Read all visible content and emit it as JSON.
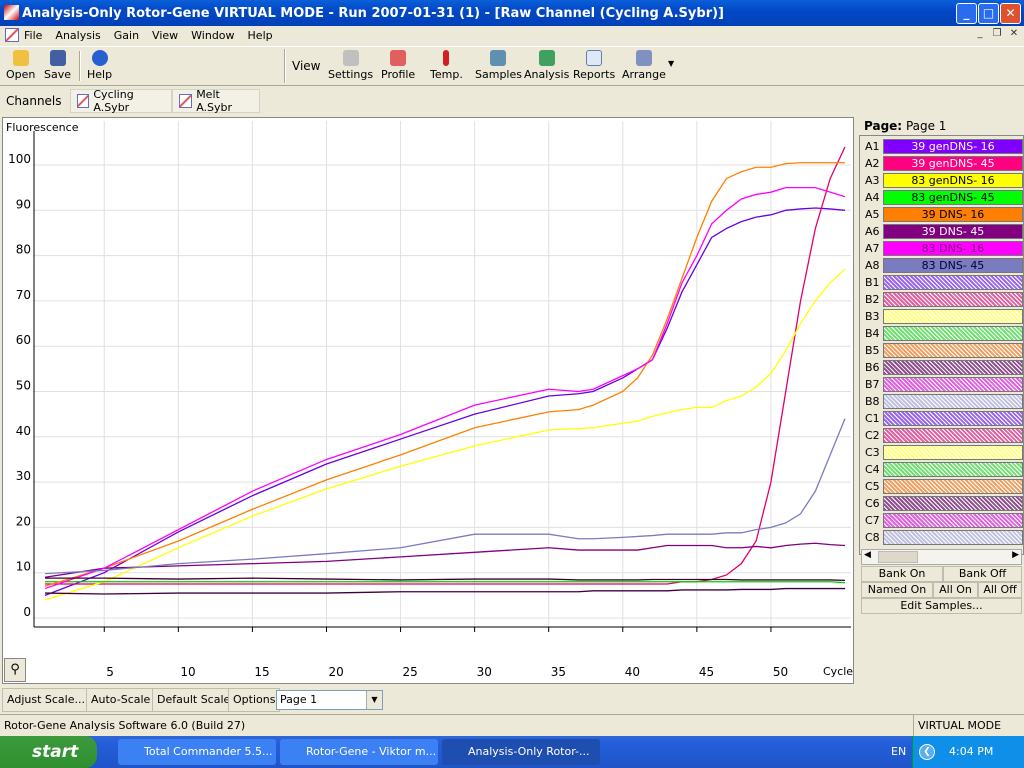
{
  "window": {
    "title": "Analysis-Only Rotor-Gene VIRTUAL MODE - Run 2007-01-31 (1) - [Raw Channel (Cycling A.Sybr)]",
    "minimize": "_",
    "maximize": "□",
    "close": "✕"
  },
  "menu": [
    "File",
    "Analysis",
    "Gain",
    "View",
    "Window",
    "Help"
  ],
  "toolbar": {
    "open": "Open",
    "save": "Save",
    "help": "Help",
    "view": "View",
    "settings": "Settings",
    "profile": "Profile",
    "temp": "Temp.",
    "samples": "Samples",
    "analysis": "Analysis",
    "reports": "Reports",
    "arrange": "Arrange"
  },
  "channels": {
    "label": "Channels",
    "items": [
      "Cycling A.Sybr",
      "Melt A.Sybr"
    ]
  },
  "panel": {
    "page_label": "Page:",
    "page_value": "Page 1",
    "samples": [
      {
        "id": "A1",
        "name": "39 genDNS- 16",
        "color": "#8000ff",
        "text": "#ffffff"
      },
      {
        "id": "A2",
        "name": "39 genDNS- 45",
        "color": "#ff0080",
        "text": "#ffffff"
      },
      {
        "id": "A3",
        "name": "83 genDNS- 16",
        "color": "#ffff00",
        "text": "#000000"
      },
      {
        "id": "A4",
        "name": "83 genDNS- 45",
        "color": "#00ff00",
        "text": "#000000"
      },
      {
        "id": "A5",
        "name": "39 DNS- 16",
        "color": "#ff8000",
        "text": "#000000"
      },
      {
        "id": "A6",
        "name": "39 DNS- 45",
        "color": "#800080",
        "text": "#ffffff"
      },
      {
        "id": "A7",
        "name": "83 DNS- 16",
        "color": "#ff00ff",
        "text": "#800080"
      },
      {
        "id": "A8",
        "name": "83 DNS- 45",
        "color": "#7b7bc0",
        "text": "#000040"
      },
      {
        "id": "B1",
        "name": "",
        "color": "#9966ee"
      },
      {
        "id": "B2",
        "name": "",
        "color": "#e060a0"
      },
      {
        "id": "B3",
        "name": "",
        "color": "#ffff80"
      },
      {
        "id": "B4",
        "name": "",
        "color": "#70e070"
      },
      {
        "id": "B5",
        "name": "",
        "color": "#f0a060"
      },
      {
        "id": "B6",
        "name": "",
        "color": "#905090"
      },
      {
        "id": "B7",
        "name": "",
        "color": "#e060e0"
      },
      {
        "id": "B8",
        "name": "",
        "color": "#c0c0e0"
      },
      {
        "id": "C1",
        "name": "",
        "color": "#9966ee"
      },
      {
        "id": "C2",
        "name": "",
        "color": "#e060a0"
      },
      {
        "id": "C3",
        "name": "",
        "color": "#ffff80"
      },
      {
        "id": "C4",
        "name": "",
        "color": "#70e070"
      },
      {
        "id": "C5",
        "name": "",
        "color": "#f0a060"
      },
      {
        "id": "C6",
        "name": "",
        "color": "#905090"
      },
      {
        "id": "C7",
        "name": "",
        "color": "#e060e0"
      },
      {
        "id": "C8",
        "name": "",
        "color": "#c0c0e0"
      }
    ],
    "bank_on": "Bank On",
    "bank_off": "Bank Off",
    "named_on": "Named On",
    "all_on": "All On",
    "all_off": "All Off",
    "edit_samples": "Edit Samples..."
  },
  "bottom": {
    "adjust_scale": "Adjust Scale...",
    "auto_scale": "Auto-Scale",
    "default_scale": "Default Scale",
    "options": "Options",
    "page_select": "Page 1"
  },
  "status": {
    "left": "Rotor-Gene Analysis Software 6.0 (Build 27)",
    "right": "VIRTUAL MODE"
  },
  "taskbar": {
    "start": "start",
    "tasks": [
      "Total Commander 5.5...",
      "Rotor-Gene - Viktor m...",
      "Analysis-Only Rotor-..."
    ],
    "lang": "EN",
    "clock": "4:04 PM"
  },
  "chart_data": {
    "type": "line",
    "ylabel": "Fluorescence",
    "xlabel": "Cycle",
    "xlim": [
      1,
      55
    ],
    "ylim": [
      -2,
      110
    ],
    "xticks": [
      5,
      10,
      15,
      20,
      25,
      30,
      35,
      40,
      45,
      50
    ],
    "yticks": [
      0,
      10,
      20,
      30,
      40,
      50,
      60,
      70,
      80,
      90,
      100
    ],
    "grid": true,
    "x": [
      1,
      5,
      10,
      15,
      20,
      25,
      30,
      35,
      37,
      38,
      40,
      41,
      42,
      43,
      44,
      45,
      46,
      47,
      48,
      49,
      50,
      51,
      52,
      53,
      54,
      55
    ],
    "series": [
      {
        "name": "39 genDNS- 16",
        "color": "#6a00e0",
        "values": [
          5,
          10,
          19,
          27,
          34,
          39.5,
          45,
          49,
          49.5,
          50,
          53,
          55,
          57,
          64,
          72,
          78,
          84,
          86,
          87.5,
          88.5,
          89,
          90,
          90.3,
          90.5,
          90.3,
          90
        ]
      },
      {
        "name": "39 genDNS- 45",
        "color": "#e0006a",
        "values": [
          7.5,
          7.5,
          7.5,
          7.5,
          7.5,
          7.5,
          7.5,
          7.5,
          7.5,
          7.5,
          7.5,
          7.5,
          7.5,
          7.5,
          8,
          8,
          8.5,
          9.5,
          12,
          17,
          30,
          50,
          70,
          86,
          97,
          104
        ]
      },
      {
        "name": "83 genDNS- 16",
        "color": "#ffff00",
        "values": [
          4,
          8,
          15.5,
          22.5,
          28.5,
          33.5,
          38,
          41.5,
          41.8,
          42,
          43,
          43.5,
          44.5,
          45.3,
          46,
          46.5,
          46.5,
          48,
          49,
          51,
          54,
          59,
          65,
          70,
          74,
          77
        ]
      },
      {
        "name": "83 genDNS- 45",
        "color": "#00d000",
        "values": [
          8,
          8,
          8,
          8,
          8,
          8,
          8,
          8,
          8,
          8,
          8,
          8,
          8,
          8,
          8,
          8,
          8,
          8,
          8,
          8,
          8,
          8,
          8,
          8,
          8,
          7.8
        ]
      },
      {
        "name": "39 DNS- 16",
        "color": "#ff8000",
        "values": [
          7,
          11,
          17,
          24,
          30.5,
          36,
          42,
          45.5,
          46,
          47,
          50,
          53,
          58,
          66,
          75,
          84,
          92,
          97,
          98.5,
          99.5,
          99.5,
          100.3,
          100.5,
          100.5,
          100.5,
          100.5
        ]
      },
      {
        "name": "39 DNS- 45",
        "color": "#800080",
        "values": [
          9,
          11,
          11.5,
          12,
          12.5,
          13.5,
          14.5,
          15.5,
          15,
          15,
          15,
          15,
          15.5,
          16,
          16,
          16,
          16,
          15.5,
          15.5,
          15.8,
          15.5,
          16,
          16.3,
          16.5,
          16.2,
          16
        ]
      },
      {
        "name": "83 DNS- 16",
        "color": "#ff00ff",
        "values": [
          6.5,
          11,
          19.5,
          28,
          35,
          40.5,
          47,
          50.5,
          50,
          50.5,
          53.5,
          55,
          57,
          65,
          74,
          80,
          87,
          90,
          92.5,
          93.5,
          94,
          95,
          95,
          95,
          94,
          93
        ]
      },
      {
        "name": "83 DNS- 45",
        "color": "#7b7bc0",
        "values": [
          9.8,
          10.5,
          12,
          13,
          14.2,
          15.5,
          18.5,
          18.5,
          17.5,
          17.5,
          17.8,
          18,
          18.2,
          18.5,
          18.5,
          18.5,
          18.5,
          18.8,
          18.8,
          19.5,
          20,
          21,
          23,
          28,
          36,
          44
        ]
      },
      {
        "color": "#400030",
        "values": [
          8.8,
          8.8,
          8.6,
          8.8,
          8.6,
          8.4,
          8.6,
          8.6,
          8.4,
          8.4,
          8.4,
          8.4,
          8.5,
          8.5,
          8.5,
          8.5,
          8.5,
          8.5,
          8.4,
          8.4,
          8.4,
          8.4,
          8.4,
          8.4,
          8.4,
          8.3
        ]
      },
      {
        "color": "#400040",
        "values": [
          5.5,
          5.3,
          5.5,
          5.5,
          5.5,
          5.8,
          5.8,
          5.8,
          5.8,
          6,
          6,
          6,
          6,
          6,
          6.2,
          6.2,
          6.2,
          6.2,
          6.3,
          6.3,
          6.3,
          6.5,
          6.5,
          6.5,
          6.5,
          6.5
        ]
      }
    ]
  }
}
